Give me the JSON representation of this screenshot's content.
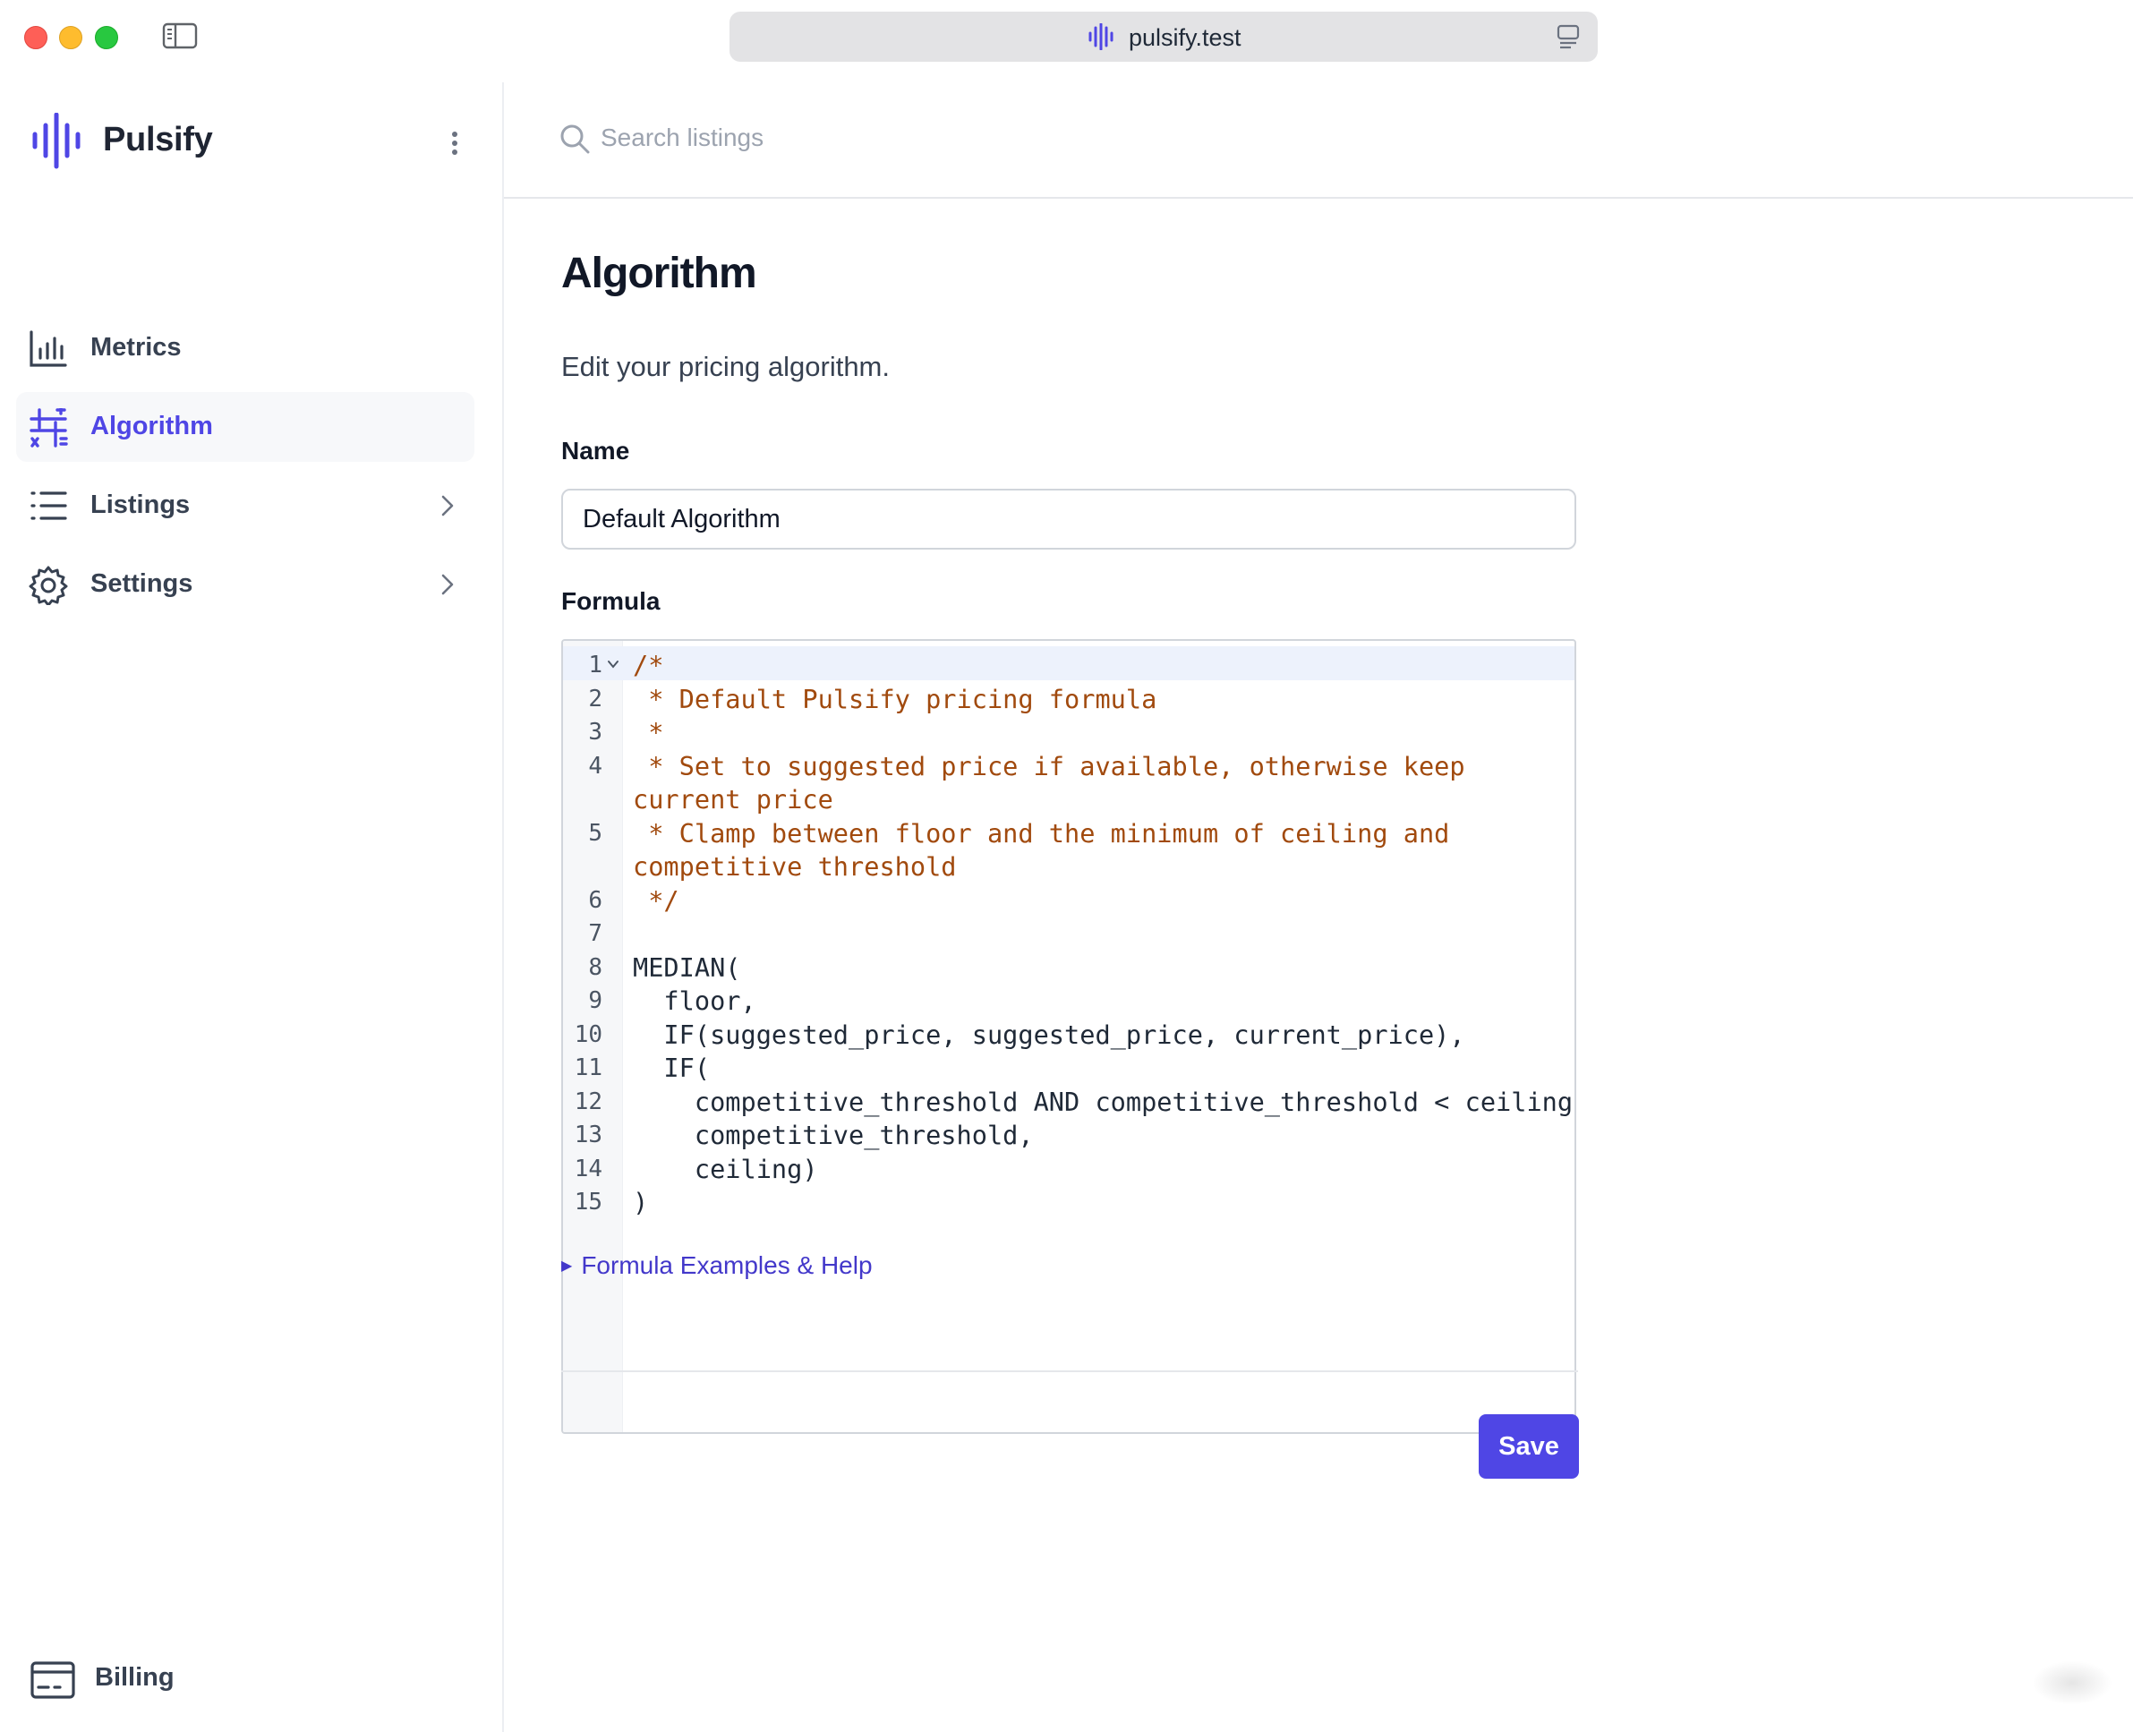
{
  "browser": {
    "url": "pulsify.test"
  },
  "brand": {
    "name": "Pulsify",
    "accent": "#4f46e5"
  },
  "sidebar": {
    "items": [
      {
        "label": "Metrics",
        "icon": "bar-chart-icon"
      },
      {
        "label": "Algorithm",
        "icon": "sliders-icon",
        "active": true
      },
      {
        "label": "Listings",
        "icon": "list-icon",
        "has_submenu": true
      },
      {
        "label": "Settings",
        "icon": "gear-icon",
        "has_submenu": true
      }
    ],
    "billing": {
      "label": "Billing",
      "icon": "credit-card-icon"
    }
  },
  "search": {
    "placeholder": "Search listings",
    "value": ""
  },
  "page": {
    "title": "Algorithm",
    "subtitle": "Edit your pricing algorithm."
  },
  "form": {
    "name_label": "Name",
    "name_value": "Default Algorithm",
    "formula_label": "Formula",
    "formula_lines": [
      {
        "n": "1",
        "text": "/*",
        "kind": "comment"
      },
      {
        "n": "2",
        "text": " * Default Pulsify pricing formula",
        "kind": "comment"
      },
      {
        "n": "3",
        "text": " *",
        "kind": "comment"
      },
      {
        "n": "4",
        "text": " * Set to suggested price if available, otherwise keep",
        "kind": "comment"
      },
      {
        "n": "",
        "text": "current price",
        "kind": "comment"
      },
      {
        "n": "5",
        "text": " * Clamp between floor and the minimum of ceiling and",
        "kind": "comment"
      },
      {
        "n": "",
        "text": "competitive threshold",
        "kind": "comment"
      },
      {
        "n": "6",
        "text": " */",
        "kind": "comment"
      },
      {
        "n": "7",
        "text": "",
        "kind": "code"
      },
      {
        "n": "8",
        "text": "MEDIAN(",
        "kind": "code"
      },
      {
        "n": "9",
        "text": "  floor,",
        "kind": "code"
      },
      {
        "n": "10",
        "text": "  IF(suggested_price, suggested_price, current_price),",
        "kind": "code"
      },
      {
        "n": "11",
        "text": "  IF(",
        "kind": "code"
      },
      {
        "n": "12",
        "text": "    competitive_threshold AND competitive_threshold < ceiling,",
        "kind": "code"
      },
      {
        "n": "13",
        "text": "    competitive_threshold,",
        "kind": "code"
      },
      {
        "n": "14",
        "text": "    ceiling)",
        "kind": "code"
      },
      {
        "n": "15",
        "text": ")",
        "kind": "code"
      }
    ],
    "help_link": "Formula Examples & Help",
    "save_label": "Save"
  }
}
